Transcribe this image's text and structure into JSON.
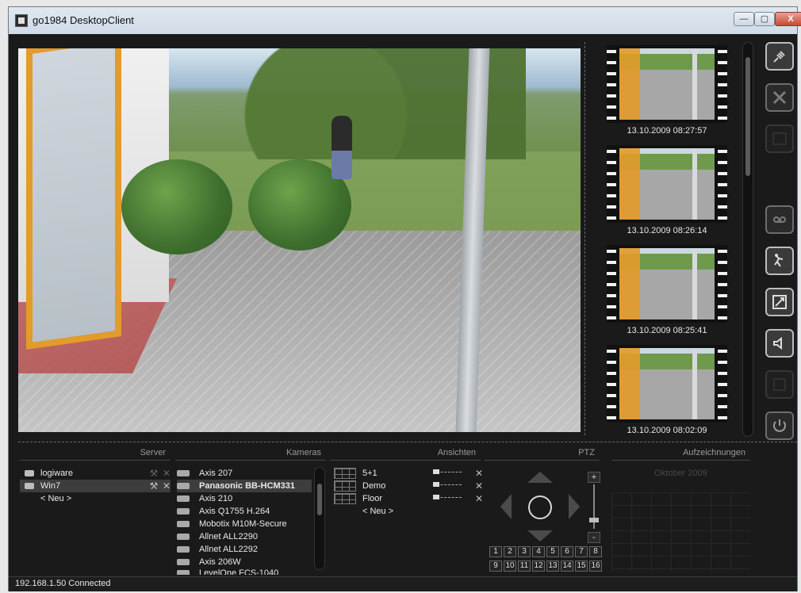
{
  "window": {
    "title": "go1984 DesktopClient",
    "controls": {
      "minimize": "—",
      "maximize": "▢",
      "close": "X"
    }
  },
  "thumbnails": [
    {
      "timestamp": "13.10.2009 08:27:57"
    },
    {
      "timestamp": "13.10.2009 08:26:14"
    },
    {
      "timestamp": "13.10.2009 08:25:41"
    },
    {
      "timestamp": "13.10.2009 08:02:09"
    }
  ],
  "panels": {
    "server": {
      "title": "Server",
      "items": [
        {
          "label": "logiware"
        },
        {
          "label": "Win7",
          "selected": true
        }
      ],
      "add_label": "< Neu >"
    },
    "cameras": {
      "title": "Kameras",
      "items": [
        {
          "label": "Axis 207"
        },
        {
          "label": "Panasonic BB-HCM331",
          "selected": true
        },
        {
          "label": "Axis 210"
        },
        {
          "label": "Axis Q1755 H.264"
        },
        {
          "label": "Mobotix M10M-Secure"
        },
        {
          "label": "Allnet ALL2290"
        },
        {
          "label": "Allnet ALL2292"
        },
        {
          "label": "Axis 206W"
        },
        {
          "label": "LevelOne FCS-1040"
        }
      ]
    },
    "views": {
      "title": "Ansichten",
      "items": [
        {
          "label": "5+1"
        },
        {
          "label": "Demo"
        },
        {
          "label": "Floor"
        }
      ],
      "add_label": "< Neu >"
    },
    "ptz": {
      "title": "PTZ",
      "zoom_plus": "+",
      "zoom_minus": "-",
      "presets": [
        "1",
        "2",
        "3",
        "4",
        "5",
        "6",
        "7",
        "8",
        "9",
        "10",
        "11",
        "12",
        "13",
        "14",
        "15",
        "16"
      ]
    },
    "recordings": {
      "title": "Aufzeichnungen",
      "month": "Oktober 2009"
    }
  },
  "status": {
    "text": "192.168.1.50 Connected"
  }
}
